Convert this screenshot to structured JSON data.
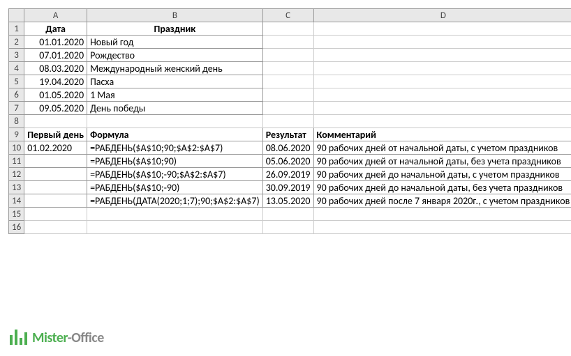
{
  "columns": {
    "A": "A",
    "B": "B",
    "C": "C",
    "D": "D"
  },
  "rows": [
    "1",
    "2",
    "3",
    "4",
    "5",
    "6",
    "7",
    "8",
    "9",
    "10",
    "11",
    "12",
    "13",
    "14",
    "15",
    "16"
  ],
  "headers1": {
    "date": "Дата",
    "holiday": "Праздник"
  },
  "holidays": [
    {
      "d": "01.01.2020",
      "n": "Новый год"
    },
    {
      "d": "07.01.2020",
      "n": "Рождество"
    },
    {
      "d": "08.03.2020",
      "n": "Международный женский день"
    },
    {
      "d": "19.04.2020",
      "n": "Пасха"
    },
    {
      "d": "01.05.2020",
      "n": "1 Мая"
    },
    {
      "d": "09.05.2020",
      "n": "День победы"
    }
  ],
  "headers2": {
    "first": "Первый день",
    "formula": "Формула",
    "result": "Результат",
    "comment": "Комментарий"
  },
  "first_day": "01.02.2020",
  "calc": [
    {
      "f": "=РАБДЕНЬ($A$10;90;$A$2:$A$7)",
      "r": "08.06.2020",
      "c": " 90 рабочих дней от начальной даты, с учетом праздников"
    },
    {
      "f": "=РАБДЕНЬ($A$10;90)",
      "r": "05.06.2020",
      "c": " 90 рабочих дней от начальной даты, без учета праздников"
    },
    {
      "f": "=РАБДЕНЬ($A$10;-90;$A$2:$A$7)",
      "r": "26.09.2019",
      "c": " 90 рабочих дней до начальной даты, с учетом праздников"
    },
    {
      "f": "=РАБДЕНЬ($A$10;-90)",
      "r": "30.09.2019",
      "c": " 90 рабочих дней до начальной даты, без учета праздников"
    },
    {
      "f": "=РАБДЕНЬ(ДАТА(2020;1;7);90;$A$2:$A$7)",
      "r": "13.05.2020",
      "c": " 90 рабочих дней после 7 января 2020г., с учетом праздников"
    }
  ],
  "logo": {
    "mister": "Mister",
    "office": "-Office"
  }
}
